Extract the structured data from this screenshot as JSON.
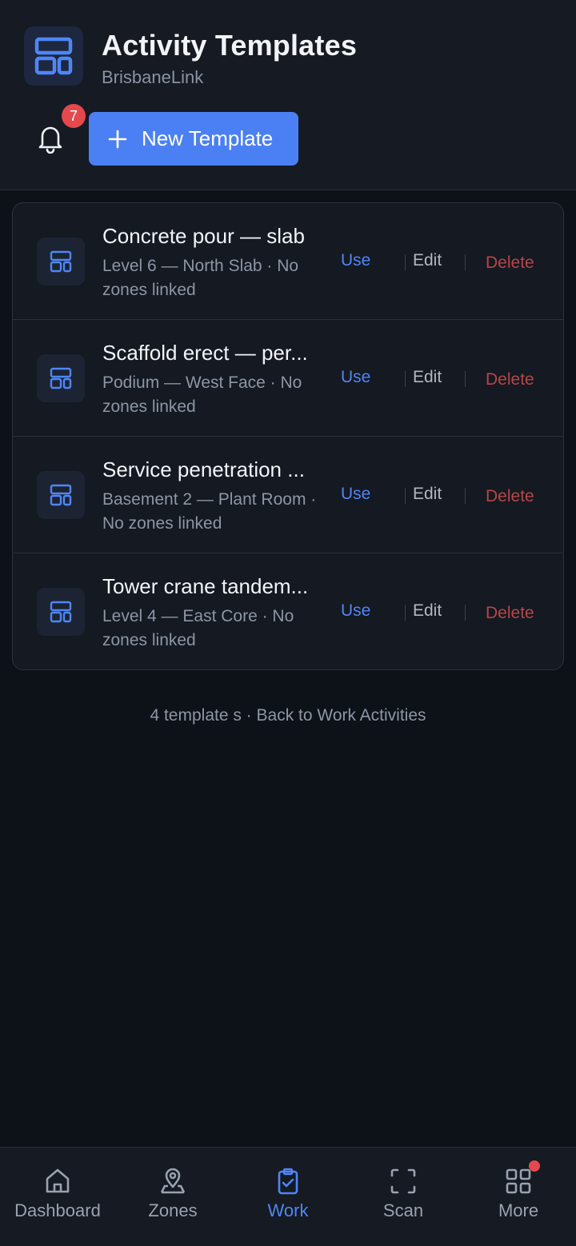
{
  "header": {
    "title": "Activity Templates",
    "subtitle": "BrisbaneLink",
    "app_icon": "layout-template-icon",
    "notifications": {
      "icon": "bell-icon",
      "count": "7"
    },
    "new_button": {
      "icon": "plus-icon",
      "label": "New Template"
    }
  },
  "templates": [
    {
      "title": "Concrete pour — slab",
      "subtitle": "Level 6 — North Slab · No zones linked",
      "use": "Use",
      "edit": "Edit",
      "delete": "Delete"
    },
    {
      "title": "Scaffold erect — per...",
      "subtitle": "Podium — West Face · No zones linked",
      "use": "Use",
      "edit": "Edit",
      "delete": "Delete"
    },
    {
      "title": "Service penetration ...",
      "subtitle": "Basement 2 — Plant Room · No zones linked",
      "use": "Use",
      "edit": "Edit",
      "delete": "Delete"
    },
    {
      "title": "Tower crane tandem...",
      "subtitle": "Level 4 — East Core · No zones linked",
      "use": "Use",
      "edit": "Edit",
      "delete": "Delete"
    }
  ],
  "footer_note": "4 template s · Back to Work Activities",
  "tabbar": [
    {
      "label": "Dashboard",
      "icon": "home-icon"
    },
    {
      "label": "Zones",
      "icon": "map-pin-icon"
    },
    {
      "label": "Work",
      "icon": "clipboard-check-icon",
      "active": true
    },
    {
      "label": "Scan",
      "icon": "scan-icon"
    },
    {
      "label": "More",
      "icon": "grid-icon",
      "has_dot": true
    }
  ],
  "colors": {
    "accent": "#4b80f4",
    "danger": "#b54747",
    "badge": "#e5484d",
    "background": "#0d1118"
  }
}
